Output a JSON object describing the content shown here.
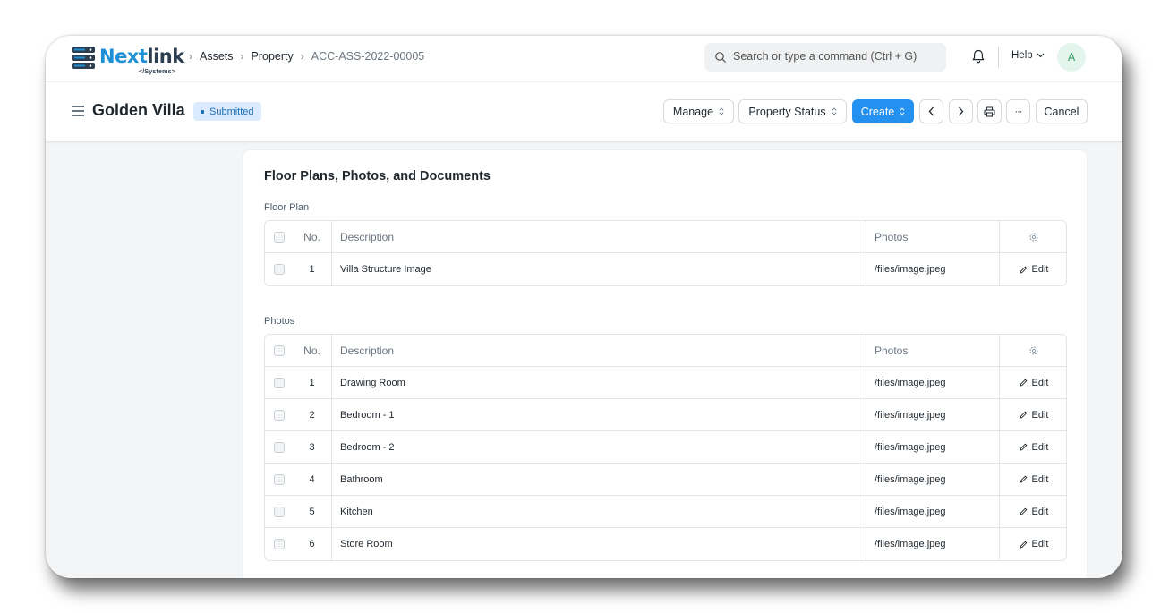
{
  "navbar": {
    "logo": {
      "brand_part1": "Next",
      "brand_part2": "link",
      "sub": "</Systems>"
    },
    "breadcrumbs": [
      "Assets",
      "Property",
      "ACC-ASS-2022-00005"
    ],
    "search_placeholder": "Search or type a command (Ctrl + G)",
    "help_label": "Help",
    "avatar_initial": "A"
  },
  "page": {
    "title": "Golden Villa",
    "status": "Submitted",
    "actions": {
      "manage": "Manage",
      "property_status": "Property Status",
      "create": "Create",
      "more": "···",
      "cancel": "Cancel"
    }
  },
  "section": {
    "title": "Floor Plans, Photos, and Documents",
    "floor_plan": {
      "label": "Floor Plan",
      "columns": {
        "no": "No.",
        "description": "Description",
        "photos": "Photos"
      },
      "rows": [
        {
          "no": "1",
          "description": "Villa Structure Image",
          "photo": "/files/image.jpeg",
          "action": "Edit"
        }
      ]
    },
    "photos": {
      "label": "Photos",
      "columns": {
        "no": "No.",
        "description": "Description",
        "photos": "Photos"
      },
      "rows": [
        {
          "no": "1",
          "description": "Drawing Room",
          "photo": "/files/image.jpeg",
          "action": "Edit"
        },
        {
          "no": "2",
          "description": "Bedroom - 1",
          "photo": "/files/image.jpeg",
          "action": "Edit"
        },
        {
          "no": "3",
          "description": "Bedroom - 2",
          "photo": "/files/image.jpeg",
          "action": "Edit"
        },
        {
          "no": "4",
          "description": "Bathroom",
          "photo": "/files/image.jpeg",
          "action": "Edit"
        },
        {
          "no": "5",
          "description": "Kitchen",
          "photo": "/files/image.jpeg",
          "action": "Edit"
        },
        {
          "no": "6",
          "description": "Store Room",
          "photo": "/files/image.jpeg",
          "action": "Edit"
        }
      ]
    }
  },
  "colors": {
    "primary": "#2490ef",
    "badge_bg": "#dbeafe",
    "badge_text": "#1b6fb3",
    "brand_blue": "#1f8fd6",
    "brand_dark": "#2c3e50"
  },
  "icons": [
    "search-icon",
    "bell-icon",
    "chevron-down-icon",
    "hamburger-icon",
    "sort-icon",
    "chevron-left-icon",
    "chevron-right-icon",
    "printer-icon",
    "settings-icon",
    "pencil-icon"
  ]
}
